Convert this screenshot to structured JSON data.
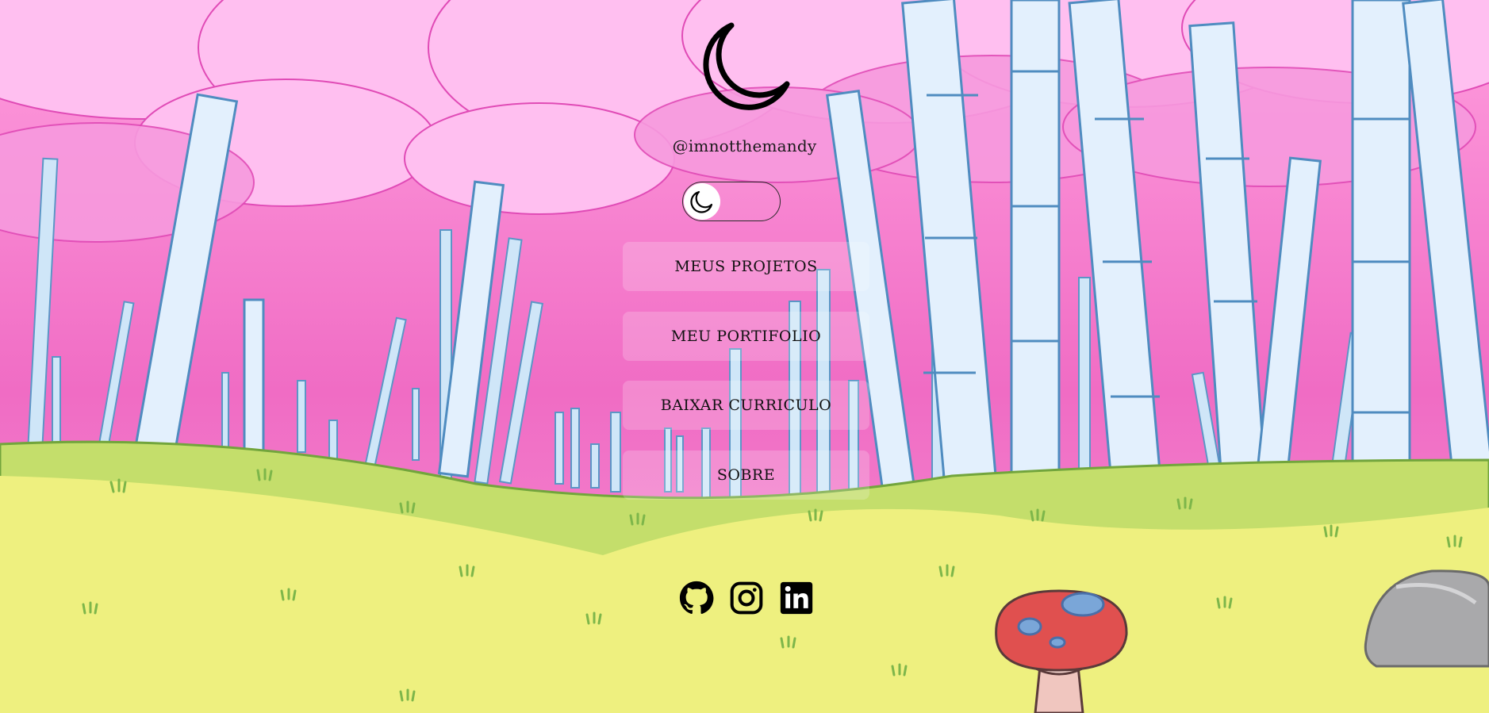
{
  "profile": {
    "avatar_icon": "crescent-moon-icon",
    "username": "@imnotthemandy"
  },
  "theme_toggle": {
    "icon": "moon-icon",
    "state": "dark"
  },
  "menu": {
    "items": [
      {
        "label": "MEUS PROJETOS"
      },
      {
        "label": "MEU PORTIFOLIO"
      },
      {
        "label": "BAIXAR CURRICULO"
      },
      {
        "label": "SOBRE"
      }
    ]
  },
  "social": {
    "items": [
      {
        "icon": "github-icon"
      },
      {
        "icon": "instagram-icon"
      },
      {
        "icon": "linkedin-icon"
      }
    ]
  },
  "colors": {
    "sky_pink": "#f577c9",
    "canopy_pink": "#ffb8ec",
    "bamboo": "#d9ecfb",
    "bamboo_outline": "#5b96c6",
    "grass": "#eeef7e",
    "grass_far": "#c6e06a",
    "mushroom_cap": "#e0504f",
    "rock": "#a9a9ab",
    "text": "#111111"
  }
}
